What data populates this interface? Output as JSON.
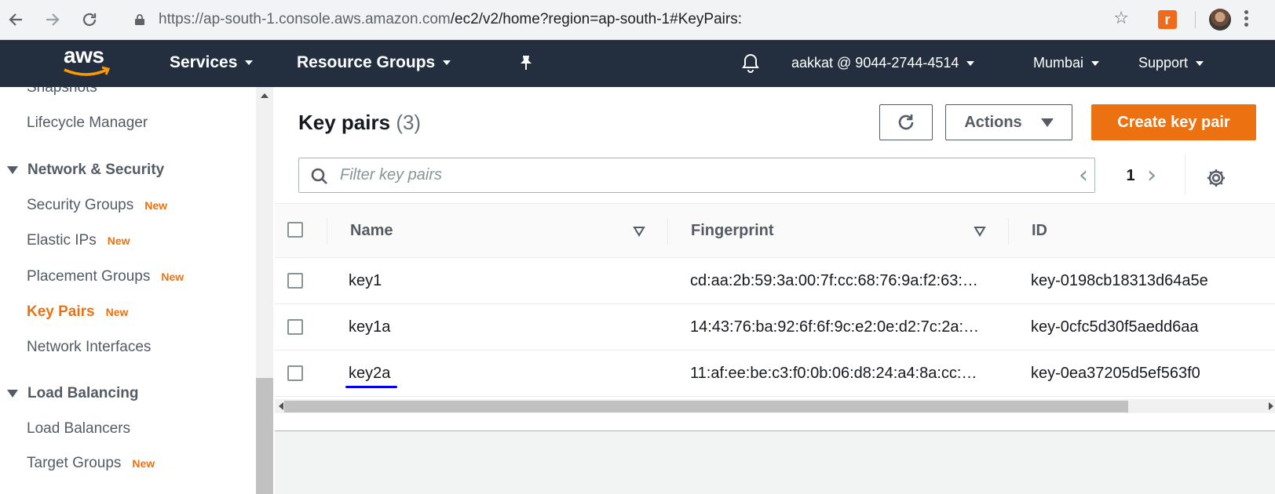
{
  "browser": {
    "back_icon": "back-arrow-icon",
    "forward_icon": "forward-arrow-icon",
    "reload_icon": "reload-icon",
    "url_host": "https://ap-south-1.console.aws.amazon.com",
    "url_path": "/ec2/v2/home?region=ap-south-1#KeyPairs:",
    "extension_glyph": "r"
  },
  "awsnav": {
    "logo": "aws",
    "services": "Services",
    "resource_groups": "Resource Groups",
    "account": "aakkat @ 9044-2744-4514",
    "region": "Mumbai",
    "support": "Support"
  },
  "sidebar": {
    "items": [
      {
        "label": "Snapshots"
      },
      {
        "label": "Lifecycle Manager"
      },
      {
        "label": "Security Groups",
        "badge": "New"
      },
      {
        "label": "Elastic IPs",
        "badge": "New"
      },
      {
        "label": "Placement Groups",
        "badge": "New"
      },
      {
        "label": "Key Pairs",
        "badge": "New",
        "active": true
      },
      {
        "label": "Network Interfaces"
      },
      {
        "label": "Load Balancers"
      },
      {
        "label": "Target Groups",
        "badge": "New"
      }
    ],
    "sections": [
      {
        "label": "Network & Security"
      },
      {
        "label": "Load Balancing"
      }
    ]
  },
  "main": {
    "title": "Key pairs",
    "count": "(3)",
    "actions_label": "Actions",
    "create_label": "Create key pair",
    "filter_placeholder": "Filter key pairs",
    "page_number": "1",
    "columns": [
      "Name",
      "Fingerprint",
      "ID"
    ],
    "rows": [
      {
        "name": "key1",
        "fingerprint": "cd:aa:2b:59:3a:00:7f:cc:68:76:9a:f2:63:…",
        "id": "key-0198cb18313d64a5e"
      },
      {
        "name": "key1a",
        "fingerprint": "14:43:76:ba:92:6f:6f:9c:e2:0e:d2:7c:2a:…",
        "id": "key-0cfc5d30f5aedd6aa"
      },
      {
        "name": "key2a",
        "fingerprint": "11:af:ee:be:c3:f0:0b:06:d8:24:a4:8a:cc:…",
        "id": "key-0ea37205d5ef563f0"
      }
    ]
  },
  "colors": {
    "aws_nav": "#232f3e",
    "accent_orange": "#ec7211"
  }
}
